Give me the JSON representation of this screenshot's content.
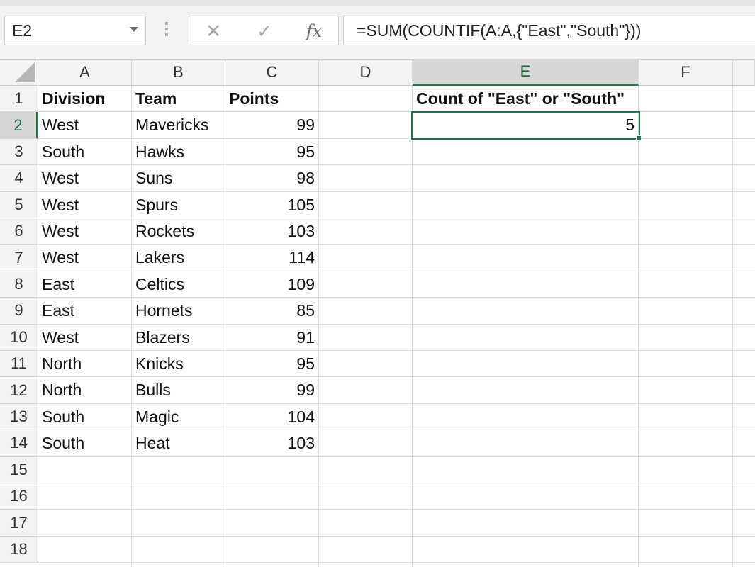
{
  "name_box": {
    "value": "E2"
  },
  "formula_bar": {
    "cancel_glyph": "✕",
    "enter_glyph": "✓",
    "fx_label": "fx",
    "formula": "=SUM(COUNTIF(A:A,{\"East\",\"South\"}))"
  },
  "columns": [
    "A",
    "B",
    "C",
    "D",
    "E",
    "F"
  ],
  "selected_column": "E",
  "rows": [
    "1",
    "2",
    "3",
    "4",
    "5",
    "6",
    "7",
    "8",
    "9",
    "10",
    "11",
    "12",
    "13",
    "14",
    "15",
    "16",
    "17",
    "18"
  ],
  "selected_row": "2",
  "table": {
    "headers": [
      "Division",
      "Team",
      "Points"
    ],
    "data": [
      [
        "West",
        "Mavericks",
        "99"
      ],
      [
        "South",
        "Hawks",
        "95"
      ],
      [
        "West",
        "Suns",
        "98"
      ],
      [
        "West",
        "Spurs",
        "105"
      ],
      [
        "West",
        "Rockets",
        "103"
      ],
      [
        "West",
        "Lakers",
        "114"
      ],
      [
        "East",
        "Celtics",
        "109"
      ],
      [
        "East",
        "Hornets",
        "85"
      ],
      [
        "West",
        "Blazers",
        "91"
      ],
      [
        "North",
        "Knicks",
        "95"
      ],
      [
        "North",
        "Bulls",
        "99"
      ],
      [
        "South",
        "Magic",
        "104"
      ],
      [
        "South",
        "Heat",
        "103"
      ]
    ]
  },
  "result": {
    "header": "Count of \"East\" or \"South\"",
    "value": "5"
  },
  "colors": {
    "accent": "#217346",
    "header_bg": "#f3f3f3",
    "selected_header_bg": "#d6d6d6"
  },
  "icons": {
    "name_box_dropdown": "chevron-down-icon",
    "cancel": "close-icon",
    "enter": "checkmark-icon",
    "function": "fx-icon",
    "select_all": "select-all-icon"
  }
}
